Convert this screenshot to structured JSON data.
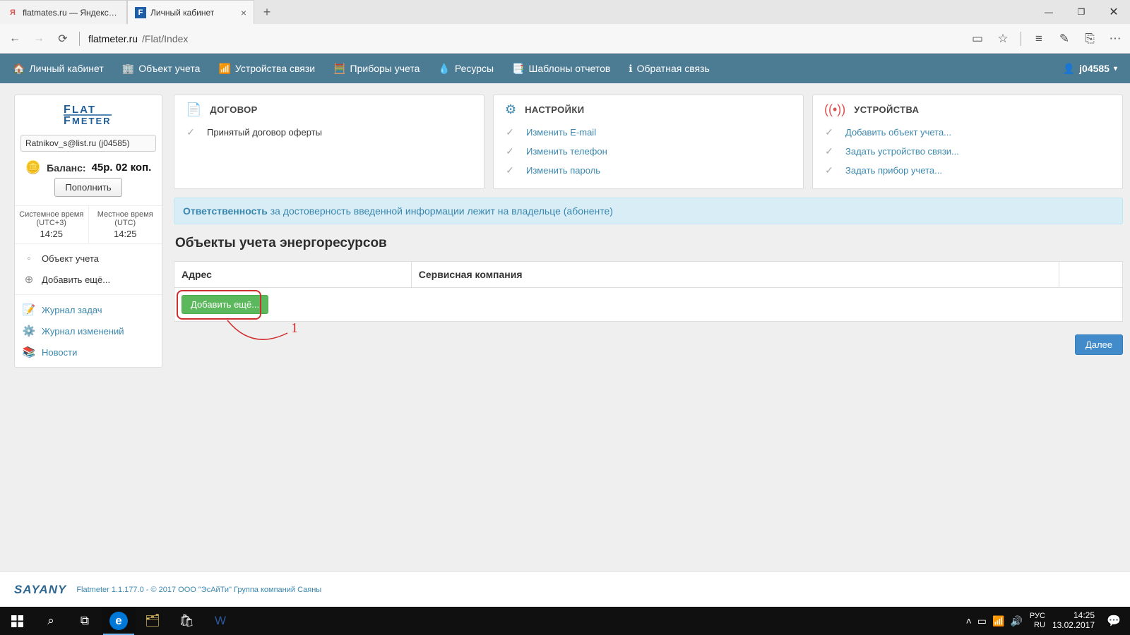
{
  "browser": {
    "tabs": [
      {
        "title": "flatmates.ru — Яндекс: наш",
        "favicon": "Я",
        "favicon_color": "#d9534f",
        "active": false
      },
      {
        "title": "Личный кабинет",
        "favicon": "F",
        "favicon_color": "#1e5ea8",
        "active": true
      }
    ],
    "address_host": "flatmeter.ru",
    "address_path": "/Flat/Index"
  },
  "navbar": {
    "items": [
      {
        "icon": "home",
        "label": "Личный кабинет"
      },
      {
        "icon": "building",
        "label": "Объект учета"
      },
      {
        "icon": "signal",
        "label": "Устройства связи"
      },
      {
        "icon": "meter",
        "label": "Приборы учета"
      },
      {
        "icon": "drop",
        "label": "Ресурсы"
      },
      {
        "icon": "template",
        "label": "Шаблоны отчетов"
      },
      {
        "icon": "info",
        "label": "Обратная связь"
      }
    ],
    "username": "j04585"
  },
  "sidebar": {
    "logo_top": "FLAT",
    "logo_bottom": "METER",
    "user_email": "Ratnikov_s@list.ru (j04585)",
    "balance_label": "Баланс:",
    "balance_value": "45р. 02 коп.",
    "topup": "Пополнить",
    "system_time_label": "Системное время (UTC+3)",
    "local_time_label": "Местное время (UTC)",
    "system_time": "14:25",
    "local_time": "14:25",
    "object_heading": "Объект учета",
    "add_more": "Добавить ещё...",
    "journal_tasks": "Журнал задач",
    "journal_changes": "Журнал изменений",
    "news": "Новости"
  },
  "cards": {
    "contract": {
      "title": "ДОГОВОР",
      "icon_color": "#5cb85c",
      "item": "Принятый договор оферты"
    },
    "settings": {
      "title": "НАСТРОЙКИ",
      "icon_color": "#3a87ad",
      "items": [
        "Изменить E-mail",
        "Изменить телефон",
        "Изменить пароль"
      ]
    },
    "devices": {
      "title": "УСТРОЙСТВА",
      "icon_color": "#d9534f",
      "items": [
        "Добавить объект учета...",
        "Задать устройство связи...",
        "Задать прибор учета..."
      ]
    }
  },
  "info_banner": {
    "strong": "Ответственность",
    "rest": " за достоверность введенной информации лежит на владельце (абоненте)"
  },
  "section_title": "Объекты учета энергоресурсов",
  "table": {
    "col_address": "Адрес",
    "col_company": "Сервисная компания",
    "add_more": "Добавить ещё..."
  },
  "annotation": {
    "number": "1"
  },
  "next_button": "Далее",
  "footer": {
    "brand": "SAYANY",
    "text": "Flatmeter 1.1.177.0 - © 2017 ООО \"ЭсАйТи\" Группа компаний Саяны"
  },
  "taskbar": {
    "lang1": "РУС",
    "lang2": "RU",
    "time": "14:25",
    "date": "13.02.2017"
  }
}
